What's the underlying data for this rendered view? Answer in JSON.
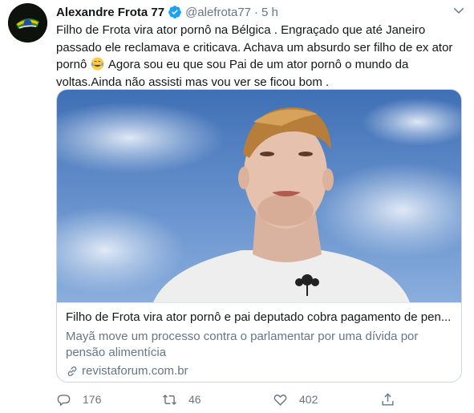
{
  "tweet": {
    "display_name": "Alexandre Frota 77",
    "handle": "@alefrota77",
    "separator": "·",
    "time": "5 h",
    "text_part1": "Filho de Frota vira ator pornô na Bélgica . Engraçado que até Janeiro passado ele reclamava e criticava. Achava um absurdo ser filho de ex ator pornô",
    "text_part2": "Agora sou eu que sou Pai de um ator pornô o mundo da voltas.Ainda não assisti mas vou ver se ficou bom .",
    "emoji": "face-with-tears-of-joy"
  },
  "card": {
    "title": "Filho de Frota vira ator pornô e pai deputado cobra pagamento de pen...",
    "description": "Mayã move um processo contra o parlamentar por uma dívida por pensão alimentícia",
    "domain": "revistaforum.com.br"
  },
  "actions": {
    "replies": "176",
    "retweets": "46",
    "likes": "402"
  },
  "colors": {
    "verified": "#1da1f2",
    "secondary_text": "#657786",
    "primary_text": "#14171a",
    "border": "#ccd6dd"
  }
}
